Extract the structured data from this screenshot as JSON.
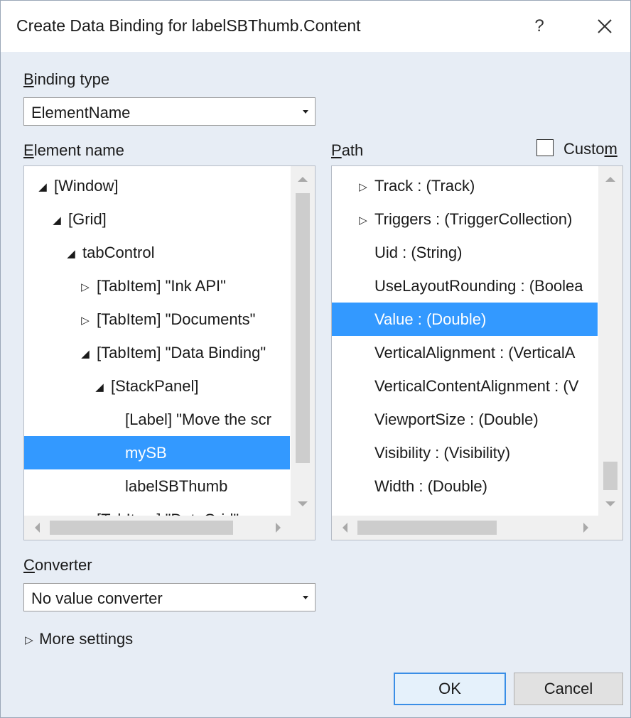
{
  "dialog": {
    "title": "Create Data Binding for labelSBThumb.Content",
    "help_label": "?",
    "close_label": "close"
  },
  "binding_type": {
    "label_accel": "B",
    "label_rest": "inding type",
    "value": "ElementName"
  },
  "element_name": {
    "label_accel": "E",
    "label_rest": "lement name",
    "tree": [
      {
        "label": "[Window]",
        "expander": "expanded"
      },
      {
        "label": "[Grid]",
        "expander": "expanded"
      },
      {
        "label": "tabControl",
        "expander": "expanded"
      },
      {
        "label": "[TabItem] \"Ink API\"",
        "expander": "collapsed"
      },
      {
        "label": "[TabItem] \"Documents\"",
        "expander": "collapsed"
      },
      {
        "label": "[TabItem] \"Data Binding\"",
        "expander": "expanded"
      },
      {
        "label": "[StackPanel]",
        "expander": "expanded"
      },
      {
        "label": "[Label] \"Move the scr",
        "expander": "none"
      },
      {
        "label": "mySB",
        "expander": "none",
        "selected": true
      },
      {
        "label": "labelSBThumb",
        "expander": "none"
      },
      {
        "label": "[TabItem] \"DataGrid\"",
        "expander": "collapsed"
      }
    ]
  },
  "path": {
    "label_accel": "P",
    "label_rest": "ath",
    "custom_label_pre": "Custo",
    "custom_label_accel": "m",
    "custom_checked": false,
    "items": [
      {
        "label": "Track : (Track)",
        "expander": "collapsed"
      },
      {
        "label": "Triggers : (TriggerCollection)",
        "expander": "collapsed"
      },
      {
        "label": "Uid : (String)",
        "expander": "none"
      },
      {
        "label": "UseLayoutRounding : (Boolea",
        "expander": "none"
      },
      {
        "label": "Value : (Double)",
        "expander": "none",
        "selected": true
      },
      {
        "label": "VerticalAlignment : (VerticalA",
        "expander": "none"
      },
      {
        "label": "VerticalContentAlignment : (V",
        "expander": "none"
      },
      {
        "label": "ViewportSize : (Double)",
        "expander": "none"
      },
      {
        "label": "Visibility : (Visibility)",
        "expander": "none"
      },
      {
        "label": "Width : (Double)",
        "expander": "none"
      }
    ]
  },
  "converter": {
    "label_accel": "C",
    "label_rest": "onverter",
    "value": "No value converter"
  },
  "more_settings": {
    "label": "More settings"
  },
  "buttons": {
    "ok": "OK",
    "cancel": "Cancel"
  },
  "colors": {
    "selection": "#3399ff",
    "dialog_bg": "#e7edf5",
    "default_button_border": "#3a8ee6"
  },
  "glyphs": {
    "expanded": "◢",
    "collapsed": "▷"
  }
}
